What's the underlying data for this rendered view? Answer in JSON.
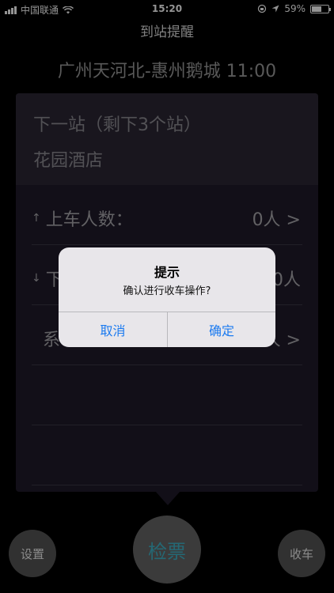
{
  "status_bar": {
    "carrier": "中国联通",
    "time": "15:20",
    "battery": "59%",
    "battery_level": 0.59,
    "icons": [
      "signal-icon",
      "wifi-icon",
      "rotation-lock-icon",
      "location-arrow-icon",
      "battery-icon"
    ]
  },
  "nav": {
    "title": "到站提醒"
  },
  "route": {
    "text": "广州天河北-惠州鹅城  11:00"
  },
  "panel": {
    "next_label": "下一站（剩下3个站）",
    "station_name": "花园酒店",
    "rows": [
      {
        "arrow": "↑",
        "label": "上车人数：",
        "value": "0人 >"
      },
      {
        "arrow": "↓",
        "label": "下",
        "value": "0人"
      },
      {
        "arrow": "",
        "label": "系",
        "value": "人 >"
      }
    ]
  },
  "controls": {
    "settings": "设置",
    "ticket": "检票",
    "close": "收车"
  },
  "alert": {
    "title": "提示",
    "message": "确认进行收车操作?",
    "cancel": "取消",
    "confirm": "确定"
  },
  "colors": {
    "accent": "#1c7bf0",
    "ticket_text": "#3fb3c8",
    "panel_bg": "#1f1b2a"
  }
}
